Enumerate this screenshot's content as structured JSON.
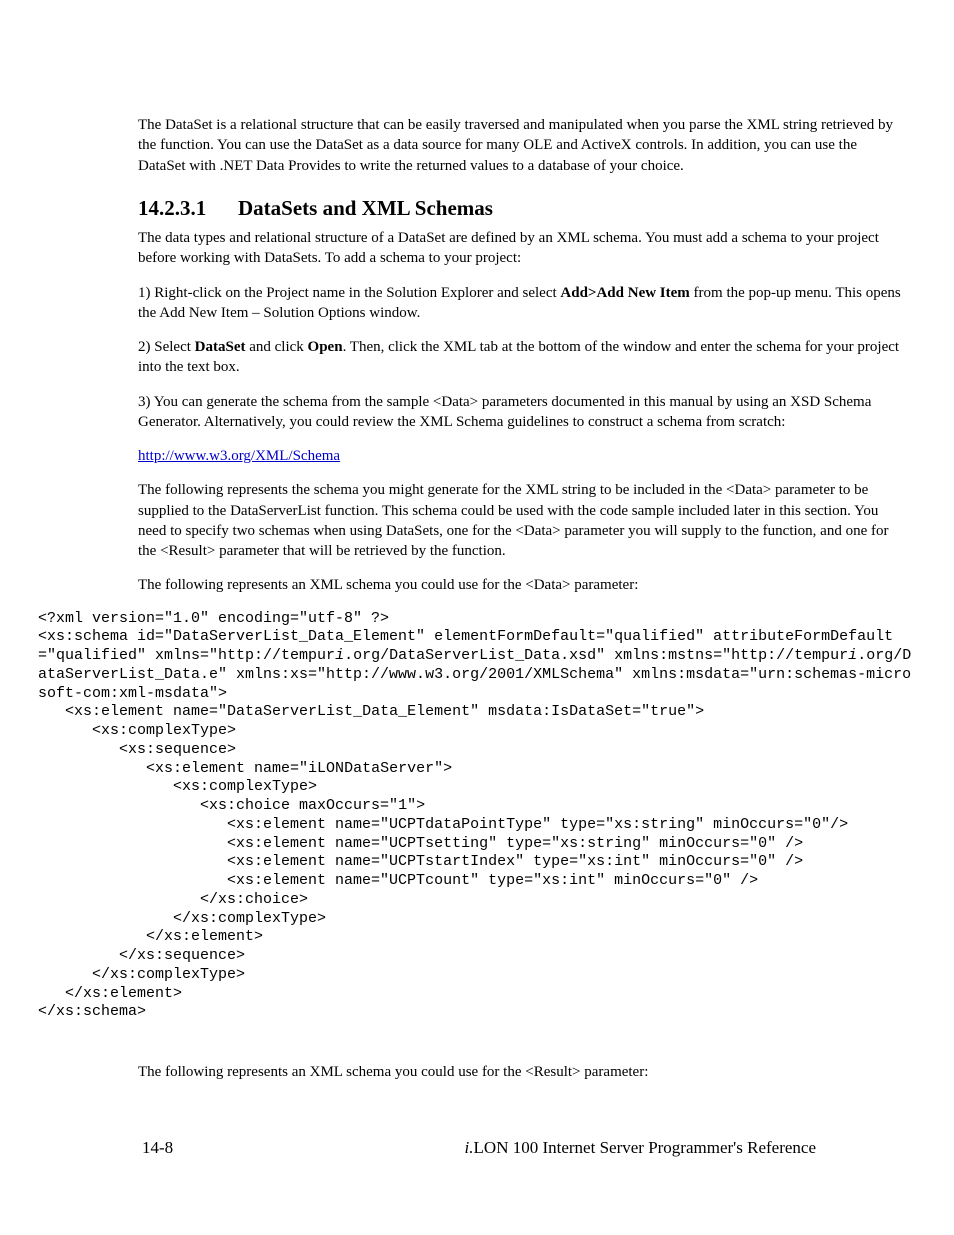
{
  "intro_para": "The DataSet is a relational structure that can be easily traversed and manipulated when you parse the XML string retrieved by the function. You can use the DataSet as a data source for many OLE and ActiveX controls. In addition, you can use the DataSet with .NET Data Provides to write the returned values to a database of your choice.",
  "section_number": "14.2.3.1",
  "section_title": "DataSets and XML Schemas",
  "p1": "The data types and relational structure of a DataSet are defined by an XML schema. You must add a schema to your project before working with DataSets. To add a schema to your project:",
  "step1_pre": "1) Right-click on the Project name in the Solution Explorer and select ",
  "step1_bold": "Add>Add New Item",
  "step1_post": " from the pop-up menu. This opens the Add New Item – Solution Options window.",
  "step2_pre": "2) Select ",
  "step2_b1": "DataSet",
  "step2_mid": " and click ",
  "step2_b2": "Open",
  "step2_post": ". Then, click the XML tab at the bottom of the window and enter the schema for your project into the text box.",
  "step3": "3) You can generate the schema from the sample <Data> parameters documented in this manual by using an XSD Schema Generator. Alternatively, you could review the XML Schema guidelines to construct a schema from scratch:",
  "schema_link": "http://www.w3.org/XML/Schema",
  "p4": "The following represents the schema you might generate for the XML string to be included in the <Data> parameter to be supplied to the DataServerList function. This schema could be used with the code sample included later in this section. You need to specify two schemas when using DataSets, one for the <Data> parameter you will supply to the function, and one for the <Result> parameter that will be retrieved by the function.",
  "p5": "The following represents an XML schema you could use for the <Data> parameter:",
  "code_before_i1": "<?xml version=\"1.0\" encoding=\"utf-8\" ?>\n<xs:schema id=\"DataServerList_Data_Element\" elementFormDefault=\"qualified\" attributeFormDefault=\"qualified\" xmlns=\"http://tempur",
  "code_i1": "i",
  "code_mid": ".org/DataServerList_Data.xsd\" xmlns:mstns=\"http://tempur",
  "code_i2": "i",
  "code_after_i2": ".org/DataServerList_Data.e\" xmlns:xs=\"http://www.w3.org/2001/XMLSchema\" xmlns:msdata=\"urn:schemas-microsoft-com:xml-msdata\">\n   <xs:element name=\"DataServerList_Data_Element\" msdata:IsDataSet=\"true\">\n      <xs:complexType>\n         <xs:sequence>\n            <xs:element name=\"iLONDataServer\">\n               <xs:complexType>\n                  <xs:choice maxOccurs=\"1\">\n                     <xs:element name=\"UCPTdataPointType\" type=\"xs:string\" minOccurs=\"0\"/>\n                     <xs:element name=\"UCPTsetting\" type=\"xs:string\" minOccurs=\"0\" />\n                     <xs:element name=\"UCPTstartIndex\" type=\"xs:int\" minOccurs=\"0\" />\n                     <xs:element name=\"UCPTcount\" type=\"xs:int\" minOccurs=\"0\" />\n                  </xs:choice>\n               </xs:complexType>\n            </xs:element>\n         </xs:sequence>\n      </xs:complexType>\n   </xs:element>\n</xs:schema>",
  "p6": "The following represents an XML schema you could use for the <Result> parameter:",
  "footer_page": "14-8",
  "footer_prefix_i": "i.",
  "footer_title": "LON 100 Internet Server Programmer's Reference"
}
